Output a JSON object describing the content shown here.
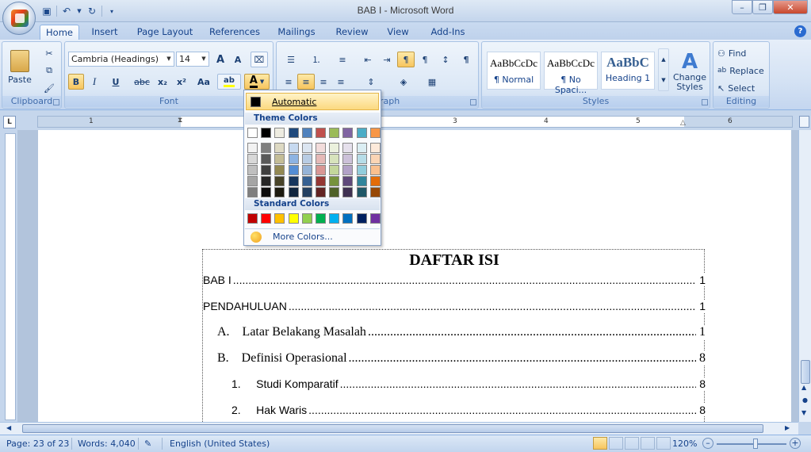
{
  "window": {
    "title": "BAB I - Microsoft Word"
  },
  "tabs": [
    "Home",
    "Insert",
    "Page Layout",
    "References",
    "Mailings",
    "Review",
    "View",
    "Add-Ins"
  ],
  "ribbon": {
    "clipboard": {
      "paste": "Paste",
      "label": "Clipboard"
    },
    "font": {
      "name": "Cambria (Headings)",
      "size": "14",
      "label": "Font",
      "bold": "B",
      "italic": "I",
      "underline": "U",
      "strike": "abc",
      "sub": "x₂",
      "sup": "x²",
      "case": "Aa",
      "grow": "A",
      "shrink": "A"
    },
    "paragraph": {
      "label": "Paragraph"
    },
    "styles": {
      "label": "Styles",
      "items": [
        {
          "sample": "AaBbCcDc",
          "name": "¶ Normal"
        },
        {
          "sample": "AaBbCcDc",
          "name": "¶ No Spaci..."
        },
        {
          "sample": "AaBbC",
          "name": "Heading 1"
        }
      ],
      "change": "Change Styles"
    },
    "editing": {
      "label": "Editing",
      "find": "Find",
      "replace": "Replace",
      "select": "Select"
    }
  },
  "color_dropdown": {
    "automatic": "Automatic",
    "theme_label": "Theme Colors",
    "standard_label": "Standard Colors",
    "more": "More Colors...",
    "theme_top": [
      "#FFFFFF",
      "#000000",
      "#EEECE1",
      "#1F497D",
      "#4F81BD",
      "#C0504D",
      "#9BBB59",
      "#8064A2",
      "#4BACC6",
      "#F79646"
    ],
    "theme_shades": [
      [
        "#F2F2F2",
        "#7F7F7F",
        "#DDD9C3",
        "#C6D9F0",
        "#DBE5F1",
        "#F2DCDB",
        "#EBF1DD",
        "#E5E0EC",
        "#DBEEF3",
        "#FDEADA"
      ],
      [
        "#D8D8D8",
        "#595959",
        "#C4BD97",
        "#8DB3E2",
        "#B8CCE4",
        "#E5B9B7",
        "#D7E3BC",
        "#CCC1D9",
        "#B7DDE8",
        "#FBD5B5"
      ],
      [
        "#BFBFBF",
        "#3F3F3F",
        "#938953",
        "#548DD4",
        "#95B3D7",
        "#D99694",
        "#C3D69B",
        "#B2A2C7",
        "#92CDDC",
        "#FAC08F"
      ],
      [
        "#A5A5A5",
        "#262626",
        "#494429",
        "#17365D",
        "#366092",
        "#953734",
        "#76923C",
        "#5F497A",
        "#31859B",
        "#E36C09"
      ],
      [
        "#7F7F7F",
        "#0C0C0C",
        "#1D1B10",
        "#0F243E",
        "#244061",
        "#632423",
        "#4F6128",
        "#3F3151",
        "#205867",
        "#974806"
      ]
    ],
    "standard": [
      "#C00000",
      "#FF0000",
      "#FFC000",
      "#FFFF00",
      "#92D050",
      "#00B050",
      "#00B0F0",
      "#0070C0",
      "#002060",
      "#7030A0"
    ]
  },
  "ruler": {
    "numbers": [
      "1",
      "1",
      "2",
      "3",
      "4",
      "5",
      "6"
    ]
  },
  "document": {
    "toc_title": "DAFTAR ISI",
    "entries": [
      {
        "label": "BAB I",
        "page": "1"
      },
      {
        "label": "PENDAHULUAN",
        "page": "1"
      },
      {
        "label": "A.    Latar Belakang Masalah",
        "page": "1"
      },
      {
        "label": "B.    Definisi Operasional",
        "page": "8"
      },
      {
        "label": "1.     Studi Komparatif",
        "page": "8"
      },
      {
        "label": "2.     Hak Waris",
        "page": "8"
      }
    ]
  },
  "status": {
    "page": "Page: 23 of 23",
    "words": "Words: 4,040",
    "language": "English (United States)",
    "zoom": "120%"
  }
}
